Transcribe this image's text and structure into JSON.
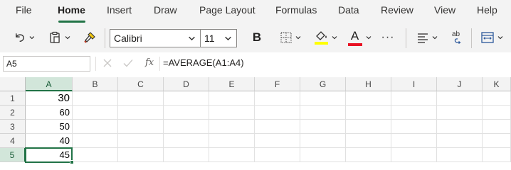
{
  "menu": {
    "tabs": [
      {
        "label": "File"
      },
      {
        "label": "Home"
      },
      {
        "label": "Insert"
      },
      {
        "label": "Draw"
      },
      {
        "label": "Page Layout"
      },
      {
        "label": "Formulas"
      },
      {
        "label": "Data"
      },
      {
        "label": "Review"
      },
      {
        "label": "View"
      },
      {
        "label": "Help"
      }
    ],
    "active_tab": "Home"
  },
  "ribbon": {
    "font_name": "Calibri",
    "font_size": "11",
    "bold_label": "B",
    "font_color_label": "A",
    "more_label": "···",
    "highlight_color": "#ffff00",
    "font_color": "#e81123",
    "icons": [
      "undo-icon",
      "paste-icon",
      "format-painter-icon",
      "borders-icon",
      "fill-color-icon",
      "font-color-icon",
      "more-icon",
      "align-icon",
      "spelling-icon",
      "wrap-text-icon"
    ]
  },
  "formula_bar": {
    "name_box": "A5",
    "fx_label": "fx",
    "formula": "=AVERAGE(A1:A4)"
  },
  "grid": {
    "columns": [
      "A",
      "B",
      "C",
      "D",
      "E",
      "F",
      "G",
      "H",
      "I",
      "J",
      "K"
    ],
    "rows": [
      "1",
      "2",
      "3",
      "4",
      "5"
    ],
    "column_a_values": [
      "30",
      "60",
      "50",
      "40",
      "45"
    ],
    "selected_cell": "A5",
    "accent_color": "#217346"
  }
}
